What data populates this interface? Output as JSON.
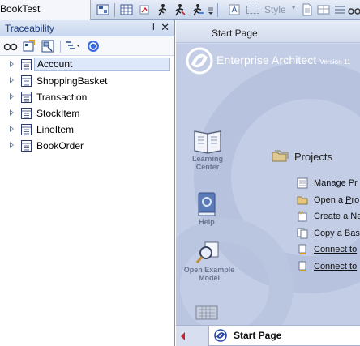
{
  "toolbar": {
    "project_title": "BookTest",
    "style_label": "Style",
    "icons": [
      "diagram-icon",
      "grid-icon",
      "filter-icon",
      "runner-icon",
      "runner-red-icon",
      "runner-blue-icon",
      "overflow-icon",
      "font-icon",
      "document-icon",
      "binoculars-icon"
    ]
  },
  "traceability": {
    "title": "Traceability",
    "pin_glyph": "ⵏ",
    "close_glyph": "✕",
    "tools": [
      "binoculars-icon",
      "element-icon",
      "locate-icon",
      "levels-icon",
      "help-icon"
    ],
    "items": [
      {
        "label": "Account",
        "selected": true
      },
      {
        "label": "ShoppingBasket",
        "selected": false
      },
      {
        "label": "Transaction",
        "selected": false
      },
      {
        "label": "StockItem",
        "selected": false
      },
      {
        "label": "LineItem",
        "selected": false
      },
      {
        "label": "BookOrder",
        "selected": false
      }
    ]
  },
  "start_page": {
    "doc_tab_title": "Start Page",
    "product_name": "Enterprise Architect",
    "version": "Version 11",
    "learning_center": [
      "Learning",
      "Center"
    ],
    "help": "Help",
    "open_example": [
      "Open Example",
      "Model"
    ],
    "projects_heading": "Projects",
    "project_items": [
      {
        "text": "Manage Pr",
        "underline": false
      },
      {
        "text": "Open a ",
        "u": "P",
        "rest": "ro"
      },
      {
        "text": "Create a ",
        "u": "N",
        "rest": "e"
      },
      {
        "text": "Copy a Bas",
        "underline": false
      },
      {
        "text": "Connect to",
        "underline": true
      },
      {
        "text": "Connect to",
        "underline": true
      }
    ],
    "bottom_tab_label": "Start Page"
  },
  "colors": {
    "accent": "#1a3a7a",
    "selection_fill": "#dde8fa",
    "startpage_bg": "#c3cde6",
    "tab_arrow": "#c0282d"
  }
}
